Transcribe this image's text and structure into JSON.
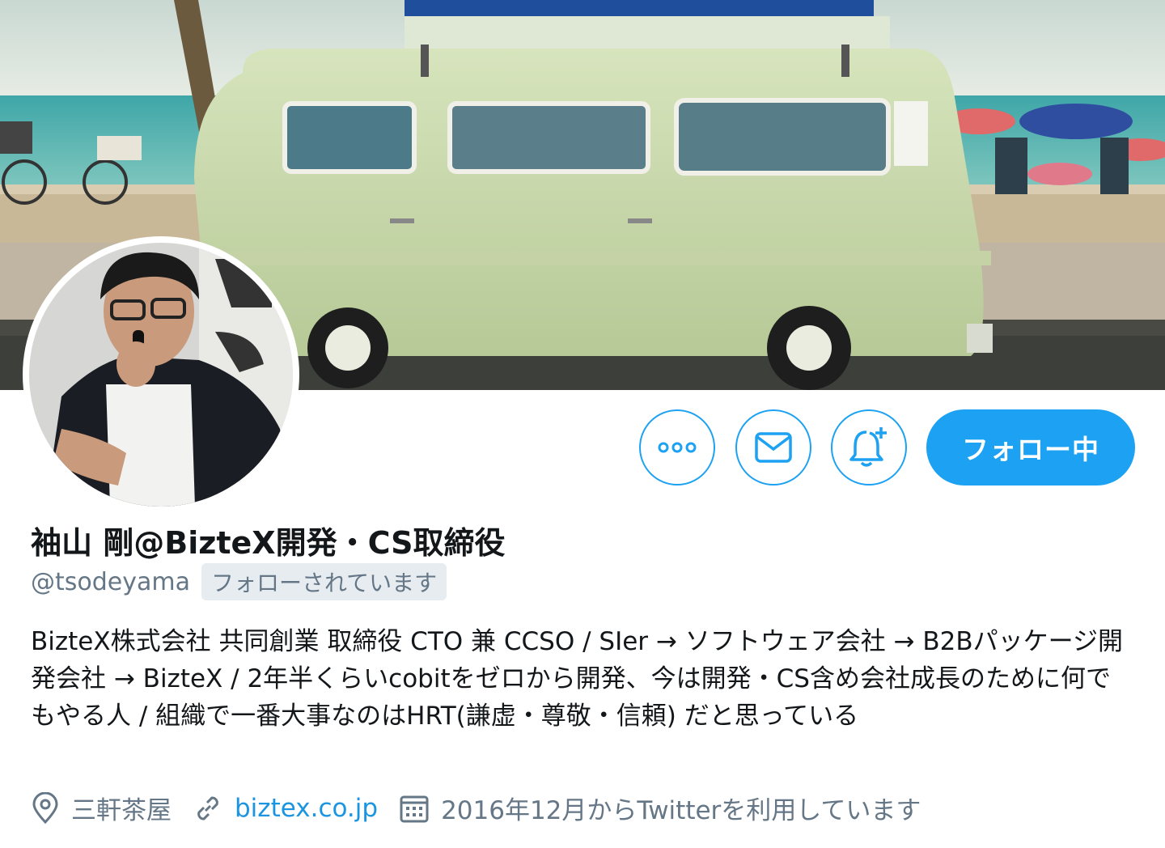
{
  "profile": {
    "display_name": "袖山 剛@BizteX開発・CS取締役",
    "handle": "@tsodeyama",
    "follows_you": "フォローされています",
    "bio": "BizteX株式会社 共同創業 取締役 CTO 兼 CCSO / SIer → ソフトウェア会社 → B2Bパッケージ開発会社 → BizteX / 2年半くらいcobitをゼロから開発、今は開発・CS含め会社成長のために何でもやる人 / 組織で一番大事なのはHRT(謙虚・尊敬・信頼) だと思っている",
    "location": "三軒茶屋",
    "website": "biztex.co.jp",
    "joined": "2016年12月からTwitterを利用しています"
  },
  "actions": {
    "follow_label": "フォロー中",
    "more_icon": "more-icon",
    "message_icon": "envelope-icon",
    "notify_icon": "bell-plus-icon"
  },
  "colors": {
    "accent": "#1da1f2",
    "secondary_text": "#657786",
    "link": "#1b95e0"
  }
}
